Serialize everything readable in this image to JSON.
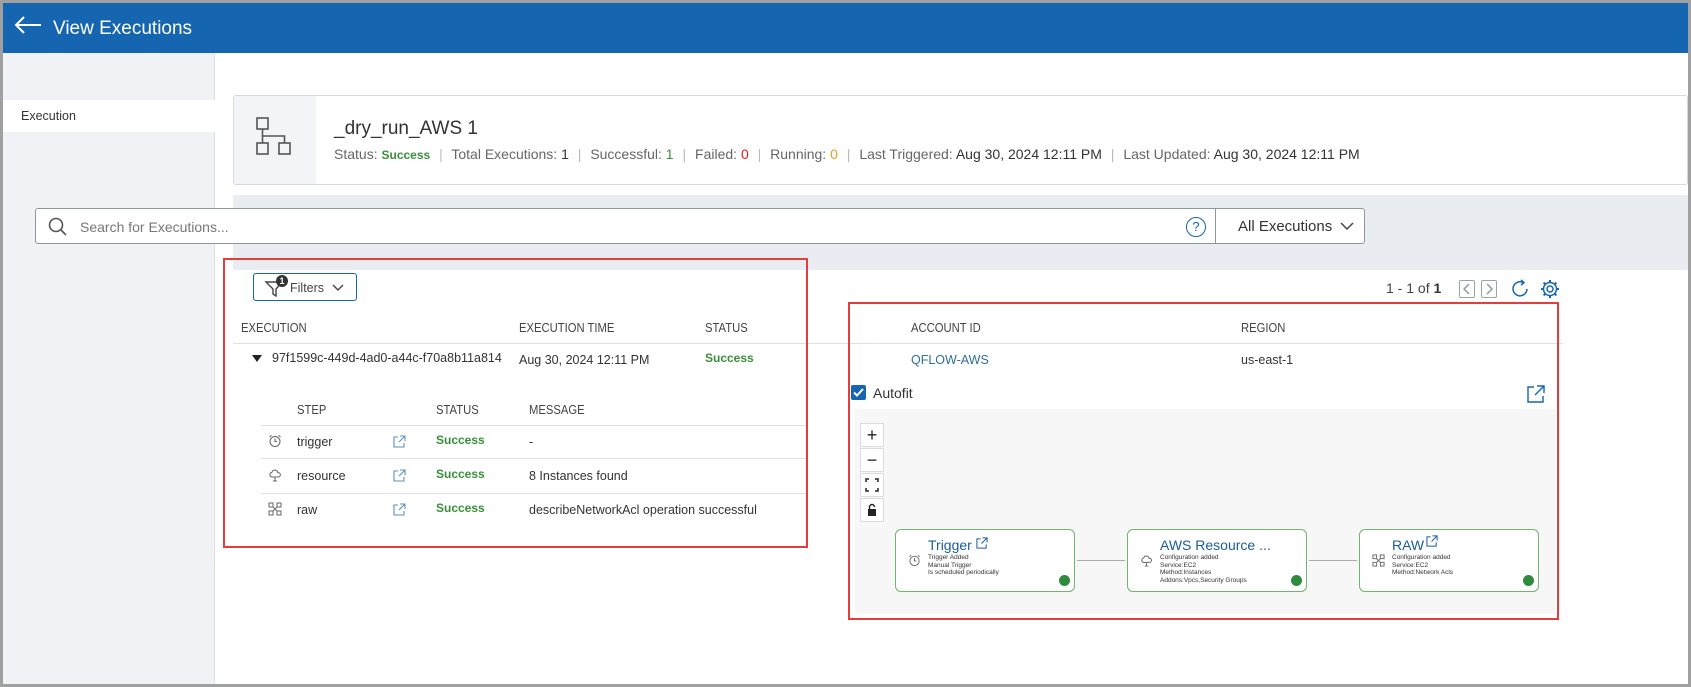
{
  "header": {
    "title": "View Executions"
  },
  "sidebar": {
    "items": [
      {
        "label": "Execution"
      }
    ]
  },
  "workflow": {
    "name": "_dry_run_AWS 1",
    "status_label": "Status:",
    "status": "Success",
    "total_label": "Total Executions:",
    "total": "1",
    "successful_label": "Successful:",
    "successful": "1",
    "failed_label": "Failed:",
    "failed": "0",
    "running_label": "Running:",
    "running": "0",
    "last_triggered_label": "Last Triggered:",
    "last_triggered": "Aug 30, 2024 12:11 PM",
    "last_updated_label": "Last Updated:",
    "last_updated": "Aug 30, 2024 12:11 PM"
  },
  "search": {
    "placeholder": "Search for Executions...",
    "help": "?",
    "filter_select": "All Executions"
  },
  "filters": {
    "label": "Filters",
    "count": "1"
  },
  "pagination": {
    "range": "1 - 1 of",
    "total": "1"
  },
  "table": {
    "columns": [
      "EXECUTION",
      "EXECUTION TIME",
      "STATUS",
      "ACCOUNT ID",
      "REGION"
    ],
    "row": {
      "execution": "97f1599c-449d-4ad0-a44c-f70a8b11a814",
      "time": "Aug 30, 2024 12:11 PM",
      "status": "Success",
      "account": "QFLOW-AWS",
      "region": "us-east-1"
    }
  },
  "steps": {
    "columns": [
      "STEP",
      "STATUS",
      "MESSAGE"
    ],
    "rows": [
      {
        "step": "trigger",
        "status": "Success",
        "message": "-",
        "icon": "alarm-clock-icon"
      },
      {
        "step": "resource",
        "status": "Success",
        "message": "8 Instances found",
        "icon": "cloud-icon"
      },
      {
        "step": "raw",
        "status": "Success",
        "message": "describeNetworkAcl operation successful",
        "icon": "network-icon"
      }
    ]
  },
  "flow": {
    "autofit_label": "Autofit",
    "autofit_checked": true,
    "tools": [
      "+",
      "−"
    ],
    "nodes": [
      {
        "title": "Trigger",
        "lines": [
          "Trigger Added",
          "Manual Trigger",
          "Is scheduled periodically"
        ]
      },
      {
        "title": "AWS Resource ...",
        "lines": [
          "Configuration added",
          "Service:EC2",
          "Method:Instances",
          "Addons:Vpcs,Security Groups"
        ]
      },
      {
        "title": "RAW",
        "lines": [
          "Configuration added",
          "Service:EC2",
          "Method:Network Acls"
        ]
      }
    ]
  },
  "colors": {
    "brand": "#1565b0",
    "success": "#3a8f3a",
    "failed": "#e02020",
    "running": "#ee9b22",
    "highlight": "#e53c3c"
  }
}
